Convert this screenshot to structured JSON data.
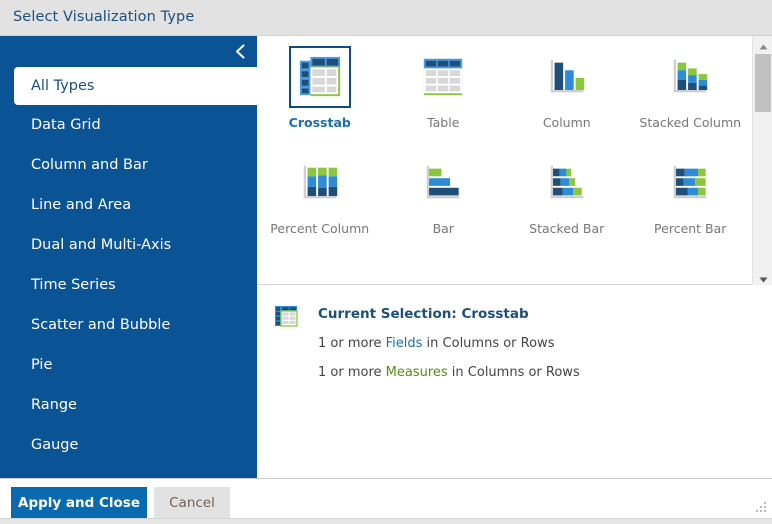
{
  "window": {
    "title": "Select Visualization Type"
  },
  "sidebar": {
    "collapse_icon": "chevron-left-icon",
    "items": [
      {
        "label": "All Types",
        "active": true
      },
      {
        "label": "Data Grid",
        "active": false
      },
      {
        "label": "Column and Bar",
        "active": false
      },
      {
        "label": "Line and Area",
        "active": false
      },
      {
        "label": "Dual and Multi-Axis",
        "active": false
      },
      {
        "label": "Time Series",
        "active": false
      },
      {
        "label": "Scatter and Bubble",
        "active": false
      },
      {
        "label": "Pie",
        "active": false
      },
      {
        "label": "Range",
        "active": false
      },
      {
        "label": "Gauge",
        "active": false
      }
    ]
  },
  "gallery": {
    "items": [
      {
        "label": "Crosstab",
        "icon": "crosstab-icon",
        "selected": true
      },
      {
        "label": "Table",
        "icon": "table-icon",
        "selected": false
      },
      {
        "label": "Column",
        "icon": "column-chart-icon",
        "selected": false
      },
      {
        "label": "Stacked Column",
        "icon": "stacked-column-icon",
        "selected": false
      },
      {
        "label": "Percent Column",
        "icon": "percent-column-icon",
        "selected": false
      },
      {
        "label": "Bar",
        "icon": "bar-chart-icon",
        "selected": false
      },
      {
        "label": "Stacked Bar",
        "icon": "stacked-bar-icon",
        "selected": false
      },
      {
        "label": "Percent Bar",
        "icon": "percent-bar-icon",
        "selected": false
      }
    ],
    "scrollbar": {
      "up_arrow": "triangle-up-icon",
      "down_arrow": "triangle-down-icon"
    }
  },
  "selection": {
    "icon": "crosstab-small-icon",
    "title": "Current Selection: Crosstab",
    "requirement_1": {
      "prefix": "1 or more ",
      "keyword": "Fields",
      "suffix": " in Columns or Rows"
    },
    "requirement_2": {
      "prefix": "1 or more ",
      "keyword": "Measures",
      "suffix": " in Columns or Rows"
    }
  },
  "footer": {
    "apply_label": "Apply and Close",
    "cancel_label": "Cancel",
    "resize_grip": "resize-grip-icon"
  },
  "colors": {
    "brand_blue": "#0a5394",
    "accent_blue": "#1a6fb0",
    "dark_navy": "#1f4e79",
    "mid_blue": "#2e8bd8",
    "green": "#8cc63e",
    "title_blue": "#1a4f80"
  }
}
